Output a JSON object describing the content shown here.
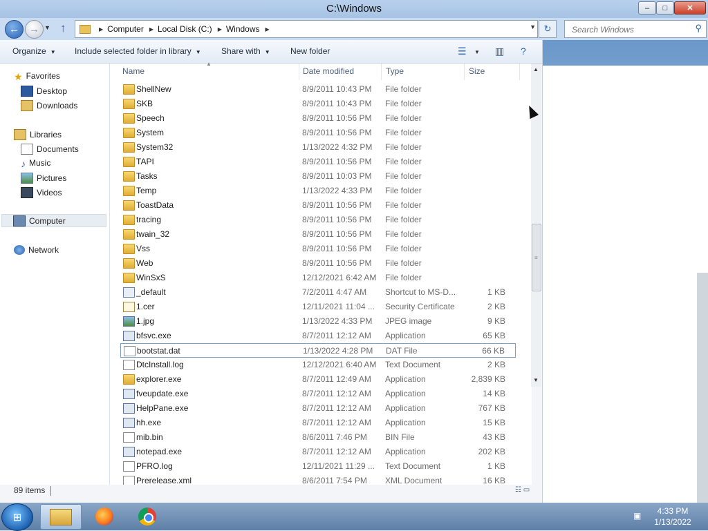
{
  "window": {
    "title": "C:\\Windows"
  },
  "titlebar_buttons": {
    "min": "–",
    "max": "□",
    "close": "✕"
  },
  "nav": {
    "back": "←",
    "forward": "→",
    "dropdown": "▼",
    "up": "↑"
  },
  "address": {
    "crumbs": [
      "Computer",
      "Local Disk (C:)",
      "Windows"
    ],
    "refresh": "↻"
  },
  "search": {
    "placeholder": "Search Windows",
    "icon": "search-icon"
  },
  "toolbar": {
    "organize": "Organize",
    "include": "Include selected folder in library",
    "share": "Share with",
    "new_folder": "New folder"
  },
  "sidebar": {
    "favorites": "Favorites",
    "desktop": "Desktop",
    "downloads": "Downloads",
    "libraries": "Libraries",
    "documents": "Documents",
    "music": "Music",
    "pictures": "Pictures",
    "videos": "Videos",
    "computer": "Computer",
    "network": "Network"
  },
  "columns": {
    "name": "Name",
    "date": "Date modified",
    "type": "Type",
    "size": "Size"
  },
  "files": [
    {
      "name": "ShellNew",
      "date": "8/9/2011 10:43 PM",
      "type": "File folder",
      "size": "",
      "icon": "folder"
    },
    {
      "name": "SKB",
      "date": "8/9/2011 10:43 PM",
      "type": "File folder",
      "size": "",
      "icon": "folder"
    },
    {
      "name": "Speech",
      "date": "8/9/2011 10:56 PM",
      "type": "File folder",
      "size": "",
      "icon": "folder"
    },
    {
      "name": "System",
      "date": "8/9/2011 10:56 PM",
      "type": "File folder",
      "size": "",
      "icon": "folder"
    },
    {
      "name": "System32",
      "date": "1/13/2022 4:32 PM",
      "type": "File folder",
      "size": "",
      "icon": "folder"
    },
    {
      "name": "TAPI",
      "date": "8/9/2011 10:56 PM",
      "type": "File folder",
      "size": "",
      "icon": "folder"
    },
    {
      "name": "Tasks",
      "date": "8/9/2011 10:03 PM",
      "type": "File folder",
      "size": "",
      "icon": "folder"
    },
    {
      "name": "Temp",
      "date": "1/13/2022 4:33 PM",
      "type": "File folder",
      "size": "",
      "icon": "folder"
    },
    {
      "name": "ToastData",
      "date": "8/9/2011 10:56 PM",
      "type": "File folder",
      "size": "",
      "icon": "folder"
    },
    {
      "name": "tracing",
      "date": "8/9/2011 10:56 PM",
      "type": "File folder",
      "size": "",
      "icon": "folder"
    },
    {
      "name": "twain_32",
      "date": "8/9/2011 10:56 PM",
      "type": "File folder",
      "size": "",
      "icon": "folder"
    },
    {
      "name": "Vss",
      "date": "8/9/2011 10:56 PM",
      "type": "File folder",
      "size": "",
      "icon": "folder"
    },
    {
      "name": "Web",
      "date": "8/9/2011 10:56 PM",
      "type": "File folder",
      "size": "",
      "icon": "folder"
    },
    {
      "name": "WinSxS",
      "date": "12/12/2021 6:42 AM",
      "type": "File folder",
      "size": "",
      "icon": "folder"
    },
    {
      "name": "_default",
      "date": "7/2/2011 4:47 AM",
      "type": "Shortcut to MS-D...",
      "size": "1 KB",
      "icon": "shortcut"
    },
    {
      "name": "1.cer",
      "date": "12/11/2021 11:04 ...",
      "type": "Security Certificate",
      "size": "2 KB",
      "icon": "cert"
    },
    {
      "name": "1.jpg",
      "date": "1/13/2022 4:33 PM",
      "type": "JPEG image",
      "size": "9 KB",
      "icon": "image"
    },
    {
      "name": "bfsvc.exe",
      "date": "8/7/2011 12:12 AM",
      "type": "Application",
      "size": "65 KB",
      "icon": "app"
    },
    {
      "name": "bootstat.dat",
      "date": "1/13/2022 4:28 PM",
      "type": "DAT File",
      "size": "66 KB",
      "icon": "file",
      "selected": true
    },
    {
      "name": "DtcInstall.log",
      "date": "12/12/2021 6:40 AM",
      "type": "Text Document",
      "size": "2 KB",
      "icon": "file"
    },
    {
      "name": "explorer.exe",
      "date": "8/7/2011 12:49 AM",
      "type": "Application",
      "size": "2,839 KB",
      "icon": "folder"
    },
    {
      "name": "fveupdate.exe",
      "date": "8/7/2011 12:12 AM",
      "type": "Application",
      "size": "14 KB",
      "icon": "app"
    },
    {
      "name": "HelpPane.exe",
      "date": "8/7/2011 12:12 AM",
      "type": "Application",
      "size": "767 KB",
      "icon": "app"
    },
    {
      "name": "hh.exe",
      "date": "8/7/2011 12:12 AM",
      "type": "Application",
      "size": "15 KB",
      "icon": "app"
    },
    {
      "name": "mib.bin",
      "date": "8/6/2011 7:46 PM",
      "type": "BIN File",
      "size": "43 KB",
      "icon": "file"
    },
    {
      "name": "notepad.exe",
      "date": "8/7/2011 12:12 AM",
      "type": "Application",
      "size": "202 KB",
      "icon": "app"
    },
    {
      "name": "PFRO.log",
      "date": "12/11/2021 11:29 ...",
      "type": "Text Document",
      "size": "1 KB",
      "icon": "file"
    },
    {
      "name": "Prerelease.xml",
      "date": "8/6/2011 7:54 PM",
      "type": "XML Document",
      "size": "16 KB",
      "icon": "file"
    }
  ],
  "status": {
    "count": "89 items"
  },
  "taskbar": {
    "start": "⊞",
    "time": "4:33 PM",
    "date": "1/13/2022"
  }
}
